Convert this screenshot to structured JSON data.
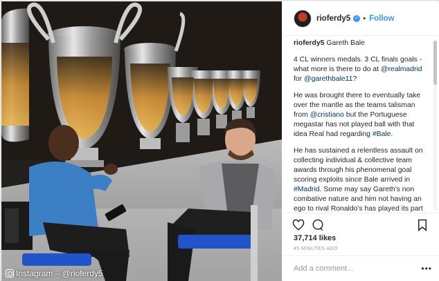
{
  "post": {
    "username": "rioferdy5",
    "follow_label": "Follow",
    "separator": "•",
    "verified_icon": "verified-badge-icon",
    "caption": {
      "author": "rioferdy5",
      "title": "Gareth Bale",
      "p1a": "4 CL winners medals. 3 CL finals goals - what more is there to do at ",
      "p1_link1": "@realmadrid",
      "p1b": " for ",
      "p1_link2": "@garethbale11",
      "p1c": "?",
      "p2a": "He was brought there to eventually take over the mantle as the teams talisman from ",
      "p2_link": "@cristiano",
      "p2b": " but the Portuguese megastar has not played ball with that idea Real had regarding ",
      "p2_tag": "#Bale",
      "p2c": ".",
      "p3a": "He has sustained a relentless assault on collecting individual & collective team awards through his phenomenal goal scoring exploits since Bale arrived in ",
      "p3_tag": "#Madrid",
      "p3b": ". Some may say Gareth's non combative nature and him not having an ego to rival Ronaldo's has played its part in holding Gareth back from going on to take the top dog spot at Madrid's top table -"
    },
    "likes": "37,714 likes",
    "time_ago": "45 MINUTES AGO",
    "comment_placeholder": "Add a comment...",
    "more_label": "•••"
  },
  "photo": {
    "watermark": "Instagram – @rioferdy5",
    "watermark_icon": "instagram-icon"
  },
  "colors": {
    "accent": "#3897f0",
    "link": "#003569",
    "muted": "#999999"
  }
}
